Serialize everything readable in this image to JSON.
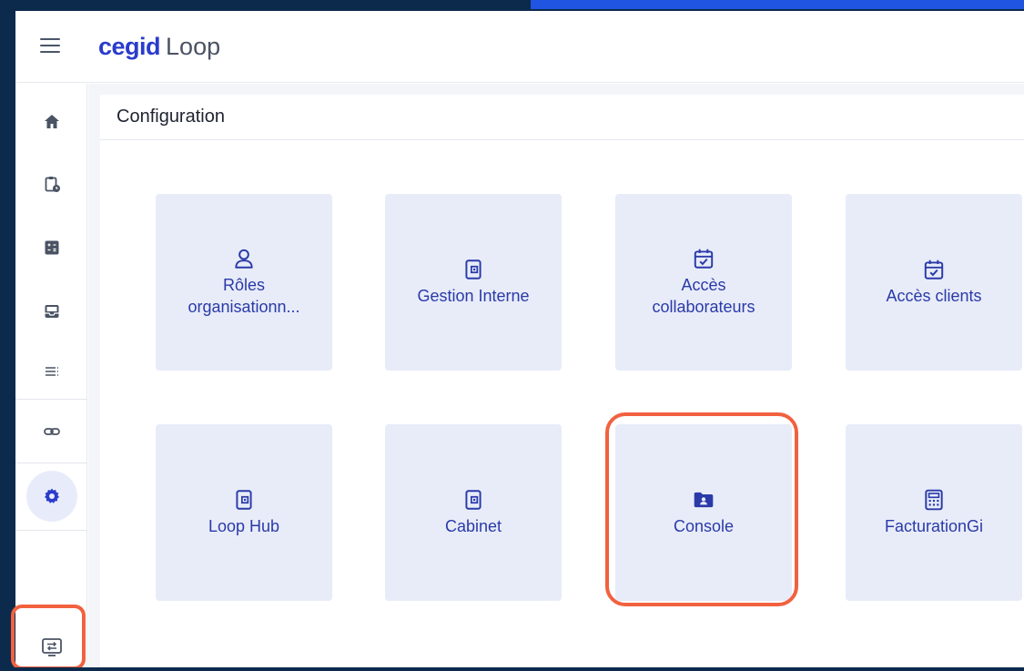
{
  "app": {
    "brand_primary": "cegid",
    "brand_secondary": "Loop",
    "brand_color": "#2a3bcc",
    "highlight_color": "#f2613f"
  },
  "sidebar": {
    "items": [
      {
        "icon": "home-icon"
      },
      {
        "icon": "clipboard-clock-icon"
      },
      {
        "icon": "calculator-icon"
      },
      {
        "icon": "inbox-icon"
      },
      {
        "icon": "list-icon"
      },
      {
        "icon": "link-icon"
      },
      {
        "icon": "gear-icon",
        "active": true
      }
    ],
    "bottom_tool_icon": "monitor-transfer-icon"
  },
  "page": {
    "title": "Configuration"
  },
  "tiles": [
    {
      "label": "Rôles organisationn...",
      "icon": "user-icon"
    },
    {
      "label": "Gestion Interne",
      "icon": "wallet-icon"
    },
    {
      "label": "Accès collaborateurs",
      "icon": "calendar-check-icon"
    },
    {
      "label": "Accès clients",
      "icon": "calendar-check-icon"
    },
    {
      "label": "Loop Hub",
      "icon": "wallet-icon"
    },
    {
      "label": "Cabinet",
      "icon": "wallet-icon"
    },
    {
      "label": "Console",
      "icon": "folder-user-icon"
    },
    {
      "label": "FacturationGi",
      "icon": "calculator-icon"
    }
  ]
}
